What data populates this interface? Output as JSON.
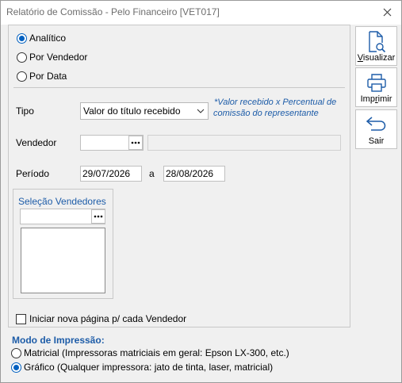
{
  "window": {
    "title": "Relatório de Comissão - Pelo Financeiro [VET017]"
  },
  "report_type": {
    "options": [
      {
        "label": "Analítico",
        "checked": true
      },
      {
        "label": "Por Vendedor",
        "checked": false
      },
      {
        "label": "Por Data",
        "checked": false
      }
    ]
  },
  "tipo": {
    "label": "Tipo",
    "selected": "Valor do título recebido",
    "note_line1": "*Valor recebido x Percentual de",
    "note_line2": "comissão do representante"
  },
  "vendedor": {
    "label": "Vendedor",
    "code": "",
    "name": ""
  },
  "periodo": {
    "label": "Período",
    "start": "29/07/2026",
    "separator": "a",
    "end": "28/08/2026"
  },
  "selecao": {
    "title": "Seleção Vendedores",
    "input": "",
    "items": []
  },
  "nova_pagina": {
    "label": "Iniciar nova página p/ cada Vendedor",
    "checked": false
  },
  "modo": {
    "title": "Modo de Impressão:",
    "options": [
      {
        "label": "Matricial (Impressoras matriciais em geral: Epson LX-300, etc.)",
        "checked": false
      },
      {
        "label": "Gráfico (Qualquer impressora: jato de tinta, laser, matricial)",
        "checked": true
      }
    ]
  },
  "buttons": {
    "visualizar": {
      "pre": "",
      "u": "V",
      "post": "isualizar",
      "icon": "document-search-icon"
    },
    "imprimir": {
      "pre": "Imp",
      "u": "r",
      "post": "imir",
      "icon": "printer-icon"
    },
    "sair": {
      "pre": "Sair",
      "u": "",
      "post": "",
      "icon": "return-arrow-icon"
    }
  },
  "colors": {
    "accent": "#0060c0",
    "label_blue": "#1d5ca8"
  }
}
